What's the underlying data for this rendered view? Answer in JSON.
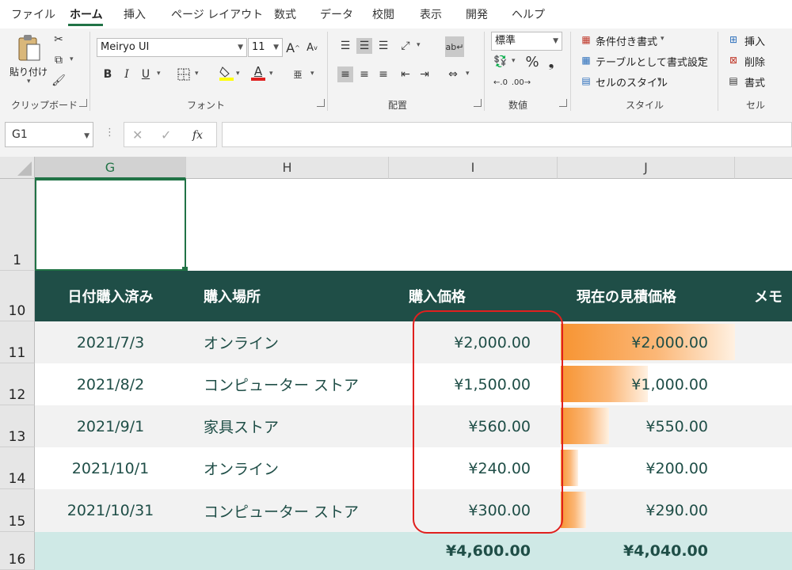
{
  "menu": {
    "tabs": [
      "ファイル",
      "ホーム",
      "挿入",
      "ページ レイアウト",
      "数式",
      "データ",
      "校閲",
      "表示",
      "開発",
      "ヘルプ"
    ],
    "active_index": 1
  },
  "ribbon": {
    "clipboard": {
      "paste_label": "貼り付け",
      "group_label": "クリップボード"
    },
    "font": {
      "font_name": "Meiryo UI",
      "font_size": "11",
      "bold": "B",
      "italic": "I",
      "underline": "U",
      "font_color_glyph": "A",
      "grow_glyph": "A",
      "shrink_glyph": "A",
      "phonetic_glyph": "亜",
      "group_label": "フォント"
    },
    "alignment": {
      "group_label": "配置"
    },
    "number": {
      "format": "標準",
      "percent": "%",
      "comma": "❟",
      "group_label": "数値"
    },
    "styles": {
      "conditional": "条件付き書式",
      "table": "テーブルとして書式設定",
      "cell_styles": "セルのスタイル",
      "group_label": "スタイル"
    },
    "cells": {
      "insert": "挿入",
      "delete": "削除",
      "format": "書式",
      "group_label": "セル"
    }
  },
  "formula_bar": {
    "name_box": "G1",
    "fx": "fx",
    "formula": ""
  },
  "grid": {
    "columns": [
      "G",
      "H",
      "I",
      "J"
    ],
    "selected_column": "G",
    "rows": [
      "1",
      "10",
      "11",
      "12",
      "13",
      "14",
      "15",
      "16"
    ],
    "headers": [
      "日付購入済み",
      "購入場所",
      "購入価格",
      "現在の見積価格",
      "メモ"
    ],
    "data": [
      {
        "date": "2021/7/3",
        "place": "オンライン",
        "price": "¥2,000.00",
        "estimate": "¥2,000.00",
        "bar": 1.0
      },
      {
        "date": "2021/8/2",
        "place": "コンピューター ストア",
        "price": "¥1,500.00",
        "estimate": "¥1,000.00",
        "bar": 0.5
      },
      {
        "date": "2021/9/1",
        "place": "家具ストア",
        "price": "¥560.00",
        "estimate": "¥550.00",
        "bar": 0.275
      },
      {
        "date": "2021/10/1",
        "place": "オンライン",
        "price": "¥240.00",
        "estimate": "¥200.00",
        "bar": 0.1
      },
      {
        "date": "2021/10/31",
        "place": "コンピューター ストア",
        "price": "¥300.00",
        "estimate": "¥290.00",
        "bar": 0.145
      }
    ],
    "totals": {
      "price": "¥4,600.00",
      "estimate": "¥4,040.00"
    }
  },
  "colors": {
    "accent": "#217346",
    "header_fill": "#1f4e47",
    "band_fill": "#f2f2f2",
    "total_fill": "#cfe9e6",
    "highlight": "#e0201e",
    "databar": "#f79432"
  }
}
